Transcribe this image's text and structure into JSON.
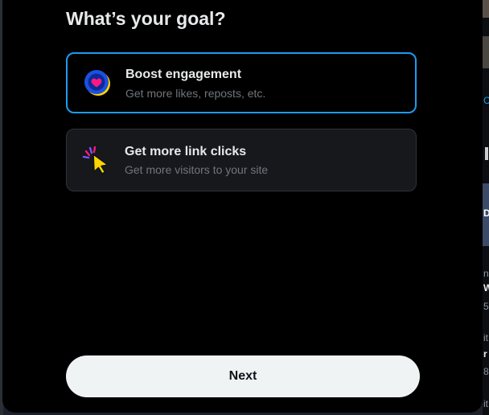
{
  "dialog": {
    "title": "What’s your goal?",
    "options": [
      {
        "label": "Boost engagement",
        "description": "Get more likes, reposts, etc.",
        "icon": "heart-badge-icon",
        "selected": true
      },
      {
        "label": "Get more link clicks",
        "description": "Get more visitors to your site",
        "icon": "cursor-click-icon",
        "selected": false
      }
    ],
    "next_label": "Next"
  },
  "background_fragments": [
    "C",
    "D",
    "n",
    "W",
    "5",
    "it",
    "r",
    "8",
    "it"
  ],
  "colors": {
    "modal_bg": "#000000",
    "option_bg": "#16181c",
    "selected_border": "#1d9bf0",
    "text_primary": "#e7e9ea",
    "text_secondary": "#71767b",
    "button_bg": "#eff3f4",
    "button_text": "#0f1419"
  }
}
